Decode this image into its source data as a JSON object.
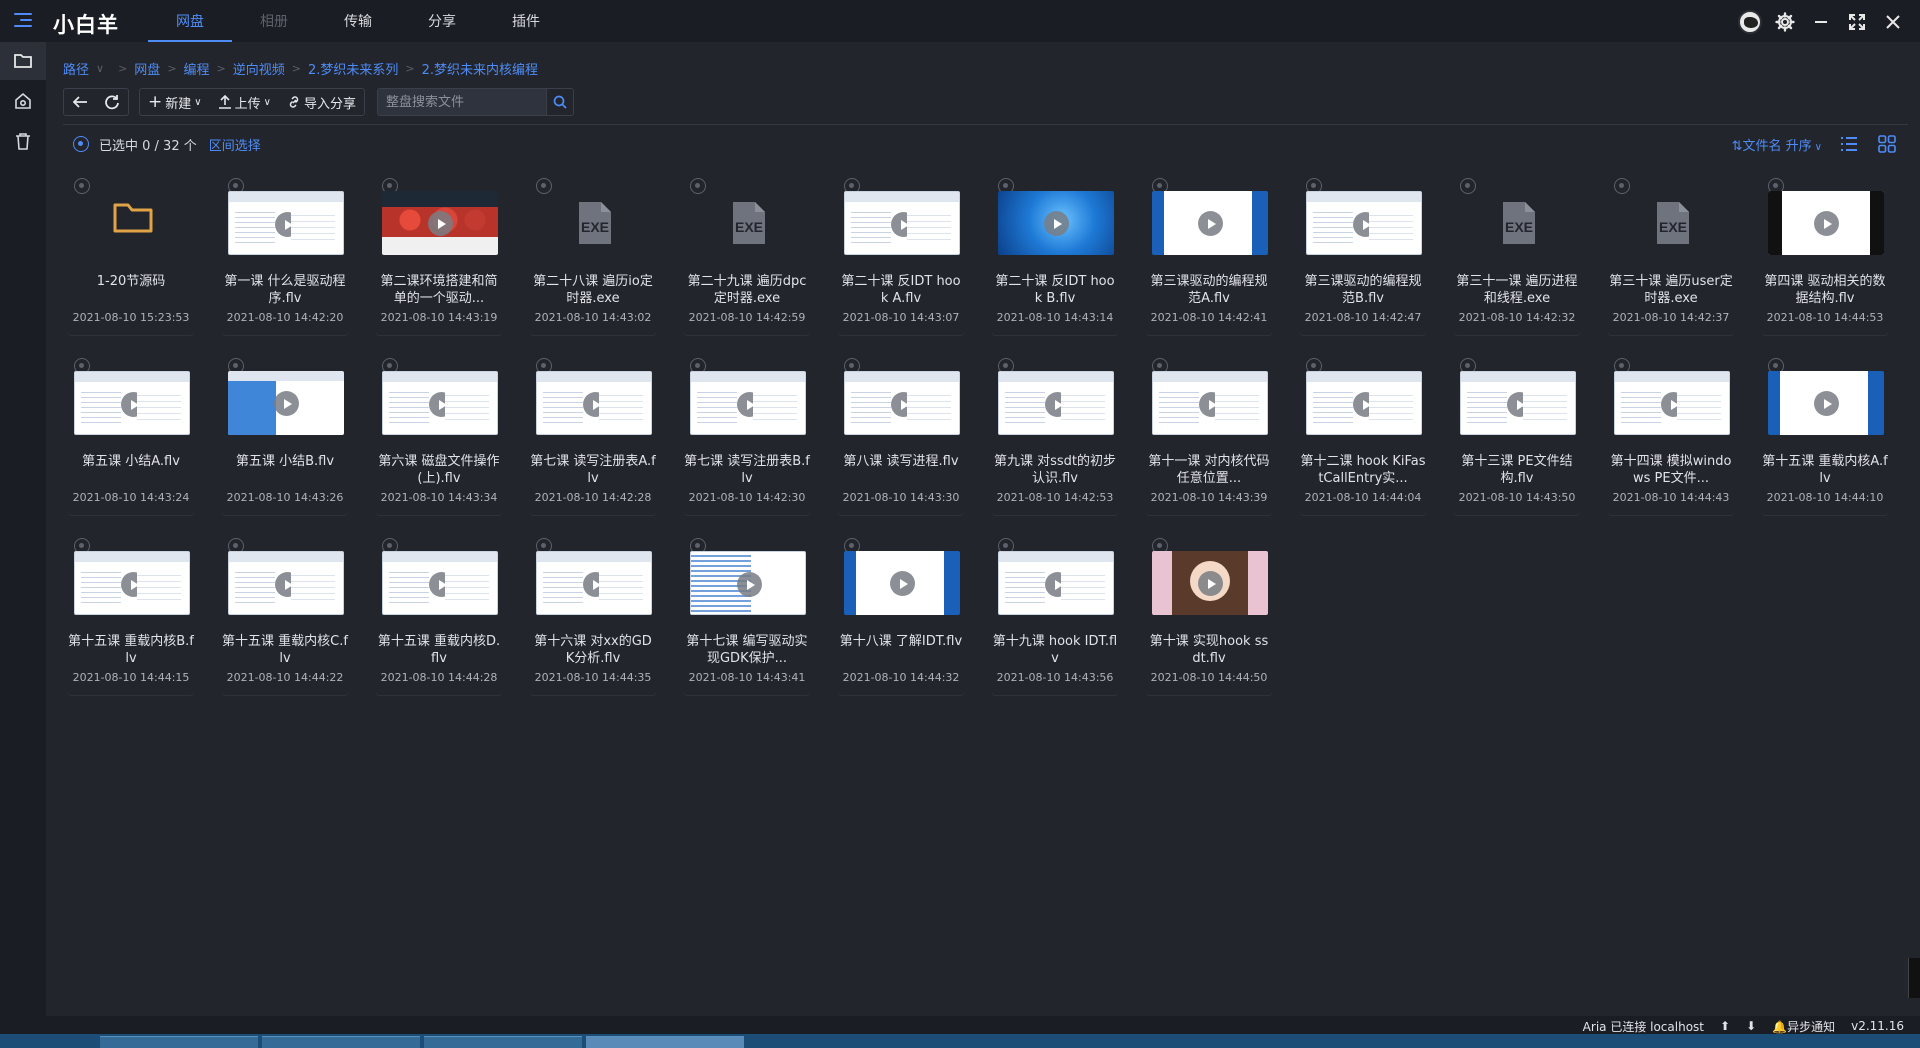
{
  "app": {
    "brand": "小白羊",
    "tabs": [
      {
        "label": "网盘",
        "state": "active"
      },
      {
        "label": "相册",
        "state": "disabled"
      },
      {
        "label": "传输",
        "state": "normal"
      },
      {
        "label": "分享",
        "state": "normal"
      },
      {
        "label": "插件",
        "state": "normal"
      }
    ],
    "colors": {
      "accent": "#4e8cf5",
      "background": "#23252d",
      "bar": "#1b1d24"
    }
  },
  "rail": {
    "items": [
      {
        "icon": "folder-icon",
        "active": true
      },
      {
        "icon": "safe-box-icon",
        "active": false
      },
      {
        "icon": "trash-icon",
        "active": false
      }
    ]
  },
  "breadcrumb": {
    "root": "路径",
    "items": [
      "网盘",
      "编程",
      "逆向视频",
      "2.梦织未来系列",
      "2.梦织未来内核编程"
    ]
  },
  "toolbar": {
    "new_label": "新建",
    "upload_label": "上传",
    "import_share_label": "导入分享",
    "search_placeholder": "整盘搜索文件"
  },
  "selection": {
    "count_text": "已选中 0 / 32 个",
    "range_label": "区间选择"
  },
  "sort": {
    "label": "文件名 升序"
  },
  "files": [
    {
      "name": "1-20节源码",
      "date": "2021-08-10 15:23:53",
      "kind": "folder"
    },
    {
      "name": "第一课 什么是驱动程序.flv",
      "date": "2021-08-10 14:42:20",
      "kind": "video",
      "thumb": "shot-white"
    },
    {
      "name": "第二课环境搭建和简单的一个驱动...",
      "date": "2021-08-10 14:43:19",
      "kind": "video",
      "thumb": "shot-red"
    },
    {
      "name": "第二十八课 遍历io定时器.exe",
      "date": "2021-08-10 14:43:02",
      "kind": "exe"
    },
    {
      "name": "第二十九课 遍历dpc定时器.exe",
      "date": "2021-08-10 14:42:59",
      "kind": "exe"
    },
    {
      "name": "第二十课 反IDT hook A.flv",
      "date": "2021-08-10 14:43:07",
      "kind": "video",
      "thumb": "shot-white"
    },
    {
      "name": "第二十课 反IDT hook B.flv",
      "date": "2021-08-10 14:43:14",
      "kind": "video",
      "thumb": "shot-desk"
    },
    {
      "name": "第三课驱动的编程规范A.flv",
      "date": "2021-08-10 14:42:41",
      "kind": "video",
      "thumb": "shot-desk2"
    },
    {
      "name": "第三课驱动的编程规范B.flv",
      "date": "2021-08-10 14:42:47",
      "kind": "video",
      "thumb": "shot-white"
    },
    {
      "name": "第三十一课 遍历进程和线程.exe",
      "date": "2021-08-10 14:42:32",
      "kind": "exe"
    },
    {
      "name": "第三十课 遍历user定时器.exe",
      "date": "2021-08-10 14:42:37",
      "kind": "exe"
    },
    {
      "name": "第四课 驱动相关的数据结构.flv",
      "date": "2021-08-10 14:44:53",
      "kind": "video",
      "thumb": "shot-dark"
    },
    {
      "name": "第五课 小结A.flv",
      "date": "2021-08-10 14:43:24",
      "kind": "video",
      "thumb": "shot-white"
    },
    {
      "name": "第五课 小结B.flv",
      "date": "2021-08-10 14:43:26",
      "kind": "video",
      "thumb": "shot-blue"
    },
    {
      "name": "第六课 磁盘文件操作(上).flv",
      "date": "2021-08-10 14:43:34",
      "kind": "video",
      "thumb": "shot-white"
    },
    {
      "name": "第七课 读写注册表A.flv",
      "date": "2021-08-10 14:42:28",
      "kind": "video",
      "thumb": "shot-white"
    },
    {
      "name": "第七课 读写注册表B.flv",
      "date": "2021-08-10 14:42:30",
      "kind": "video",
      "thumb": "shot-white"
    },
    {
      "name": "第八课 读写进程.flv",
      "date": "2021-08-10 14:43:30",
      "kind": "video",
      "thumb": "shot-white"
    },
    {
      "name": "第九课 对ssdt的初步认识.flv",
      "date": "2021-08-10 14:42:53",
      "kind": "video",
      "thumb": "shot-white"
    },
    {
      "name": "第十一课 对内核代码任意位置...",
      "date": "2021-08-10 14:43:39",
      "kind": "video",
      "thumb": "shot-white"
    },
    {
      "name": "第十二课 hook KiFastCallEntry实...",
      "date": "2021-08-10 14:44:04",
      "kind": "video",
      "thumb": "shot-white"
    },
    {
      "name": "第十三课 PE文件结构.flv",
      "date": "2021-08-10 14:43:50",
      "kind": "video",
      "thumb": "shot-white"
    },
    {
      "name": "第十四课 模拟windows PE文件...",
      "date": "2021-08-10 14:44:43",
      "kind": "video",
      "thumb": "shot-white"
    },
    {
      "name": "第十五课 重载内核A.flv",
      "date": "2021-08-10 14:44:10",
      "kind": "video",
      "thumb": "shot-desk2"
    },
    {
      "name": "第十五课 重载内核B.flv",
      "date": "2021-08-10 14:44:15",
      "kind": "video",
      "thumb": "shot-white"
    },
    {
      "name": "第十五课 重载内核C.flv",
      "date": "2021-08-10 14:44:22",
      "kind": "video",
      "thumb": "shot-white"
    },
    {
      "name": "第十五课 重载内核D.flv",
      "date": "2021-08-10 14:44:28",
      "kind": "video",
      "thumb": "shot-white"
    },
    {
      "name": "第十六课 对xx的GDK分析.flv",
      "date": "2021-08-10 14:44:35",
      "kind": "video",
      "thumb": "shot-white"
    },
    {
      "name": "第十七课 编写驱动实现GDK保护...",
      "date": "2021-08-10 14:43:41",
      "kind": "video",
      "thumb": "shot-code"
    },
    {
      "name": "第十八课 了解IDT.flv",
      "date": "2021-08-10 14:44:32",
      "kind": "video",
      "thumb": "shot-desk2"
    },
    {
      "name": "第十九课 hook IDT.flv",
      "date": "2021-08-10 14:43:56",
      "kind": "video",
      "thumb": "shot-white"
    },
    {
      "name": "第十课 实现hook ssdt.flv",
      "date": "2021-08-10 14:44:50",
      "kind": "video",
      "thumb": "shot-anime"
    }
  ],
  "status": {
    "aria": "Aria 已连接 localhost",
    "notify": "异步通知",
    "version": "v2.11.16"
  }
}
